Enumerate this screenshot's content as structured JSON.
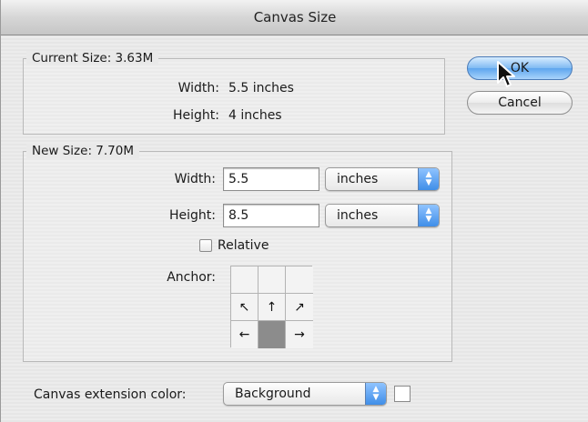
{
  "window": {
    "title": "Canvas Size"
  },
  "current_size": {
    "legend": "Current Size: 3.63M",
    "width_label": "Width:",
    "width_value": "5.5 inches",
    "height_label": "Height:",
    "height_value": "4 inches"
  },
  "new_size": {
    "legend": "New Size: 7.70M",
    "width_label": "Width:",
    "width_value": "5.5",
    "width_unit": "inches",
    "height_label": "Height:",
    "height_value": "8.5",
    "height_unit": "inches",
    "relative_label": "Relative",
    "relative_checked": false,
    "anchor_label": "Anchor:",
    "anchor_cells": [
      "",
      "",
      "",
      "↖",
      "↑",
      "↗",
      "←",
      "",
      "→"
    ],
    "anchor_selected": "bottom-center"
  },
  "buttons": {
    "ok": "OK",
    "cancel": "Cancel"
  },
  "extension": {
    "label": "Canvas extension color:",
    "value": "Background",
    "swatch_color": "#ffffff"
  },
  "colors": {
    "accent": "#5ea6ee"
  },
  "icons": {
    "cursor": "pointer-arrow-icon",
    "popup_arrows": "up-down-arrows-icon"
  }
}
